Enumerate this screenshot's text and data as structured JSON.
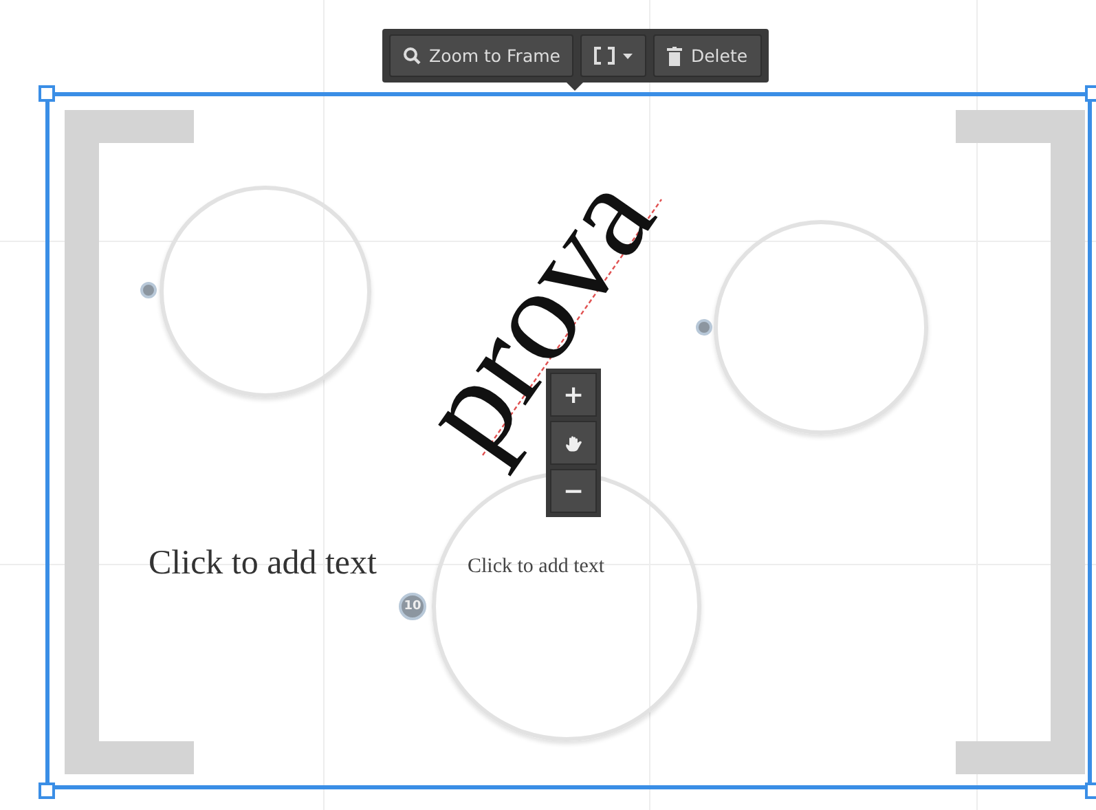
{
  "toolbar": {
    "buttons": [
      {
        "kind": "zoom",
        "label": "Zoom to Frame"
      },
      {
        "kind": "bracket"
      },
      {
        "kind": "delete",
        "label": "Delete"
      }
    ]
  },
  "canvas": {
    "circles": [
      {
        "marker": {
          "kind": "dot"
        }
      },
      {
        "marker": {
          "kind": "dot"
        }
      },
      {
        "marker": {
          "kind": "numbered",
          "label": "10"
        }
      }
    ],
    "texts": [
      {
        "kind": "rotated",
        "text": "prova"
      },
      {
        "kind": "large",
        "text": "Click to add text"
      },
      {
        "kind": "small",
        "text": "Click to add text"
      }
    ]
  },
  "zoom_controls": [
    {
      "kind": "in",
      "label": "+"
    },
    {
      "kind": "pan"
    },
    {
      "kind": "out",
      "label": "−"
    }
  ]
}
